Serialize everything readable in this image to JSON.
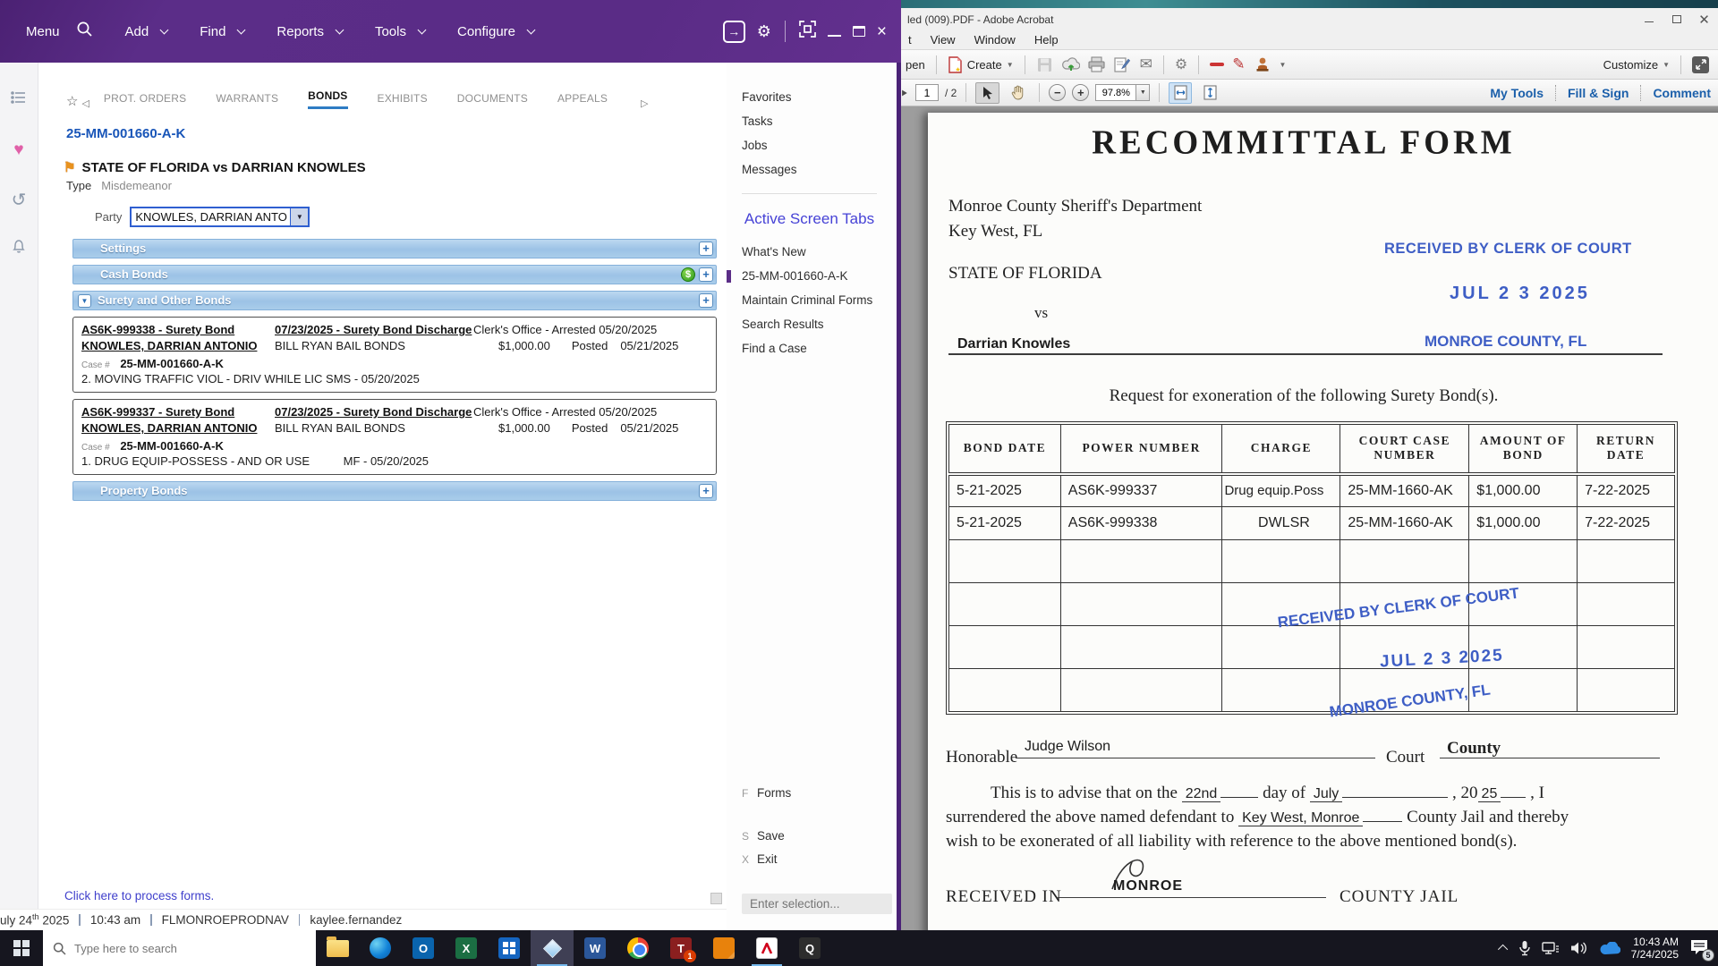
{
  "odyssey": {
    "menu": {
      "items": [
        "Menu",
        "Add",
        "Find",
        "Reports",
        "Tools",
        "Configure"
      ]
    },
    "tabs": {
      "items": [
        "PROT. ORDERS",
        "WARRANTS",
        "BONDS",
        "EXHIBITS",
        "DOCUMENTS",
        "APPEALS"
      ],
      "active": "BONDS"
    },
    "case": {
      "number": "25-MM-001660-A-K",
      "title": "STATE OF FLORIDA vs DARRIAN KNOWLES",
      "type_label": "Type",
      "type_value": "Misdemeanor",
      "party_label": "Party",
      "party_value": "KNOWLES, DARRIAN ANTO"
    },
    "sections": {
      "settings": "Settings",
      "cash_bonds": "Cash Bonds",
      "surety": "Surety and Other Bonds",
      "property": "Property Bonds"
    },
    "bonds": [
      {
        "bond_link": "AS6K-999338 - Surety Bond",
        "discharge_link": "07/23/2025 - Surety Bond Discharge",
        "status": "Clerk's Office - Arrested 05/20/2025",
        "party_link": "KNOWLES, DARRIAN ANTONIO",
        "agency": "BILL RYAN BAIL BONDS",
        "amount": "$1,000.00",
        "posted_label": "Posted",
        "posted_date": "05/21/2025",
        "case_label": "Case #",
        "case_number": "25-MM-001660-A-K",
        "charge": "2. MOVING TRAFFIC VIOL - DRIV WHILE LIC SMS - 05/20/2025",
        "charge_code": ""
      },
      {
        "bond_link": "AS6K-999337 - Surety Bond",
        "discharge_link": "07/23/2025 - Surety Bond Discharge",
        "status": "Clerk's Office - Arrested 05/20/2025",
        "party_link": "KNOWLES, DARRIAN ANTONIO",
        "agency": "BILL RYAN BAIL BONDS",
        "amount": "$1,000.00",
        "posted_label": "Posted",
        "posted_date": "05/21/2025",
        "case_label": "Case #",
        "case_number": "25-MM-001660-A-K",
        "charge": "1. DRUG EQUIP-POSSESS - AND OR USE",
        "charge_code": "MF - 05/20/2025"
      }
    ],
    "sidebar": {
      "items": [
        "Favorites",
        "Tasks",
        "Jobs",
        "Messages"
      ],
      "active_tabs_header": "Active Screen Tabs",
      "screen_tabs": [
        "What's New",
        "25-MM-001660-A-K",
        "Maintain Criminal Forms",
        "Search Results",
        "Find a Case"
      ],
      "active_screen_tab": "25-MM-001660-A-K",
      "actions": [
        {
          "key": "F",
          "label": "Forms"
        },
        {
          "key": "S",
          "label": "Save"
        },
        {
          "key": "X",
          "label": "Exit"
        }
      ],
      "selection_placeholder": "Enter selection..."
    },
    "process_forms_link": "Click here to process forms.",
    "status": {
      "date_prefix": "uly 24",
      "date_sup": "th",
      "date_suffix": "2025",
      "time": "10:43 am",
      "environment": "FLMONROEPRODNAV",
      "user": "kaylee.fernandez"
    }
  },
  "acrobat": {
    "title": "led (009).PDF - Adobe Acrobat",
    "menus": [
      "t",
      "View",
      "Window",
      "Help"
    ],
    "toolbar": {
      "open_partial": "pen",
      "create": "Create",
      "customize": "Customize",
      "page_value": "1",
      "page_total": "/ 2",
      "zoom_value": "97.8%",
      "right_tabs": [
        "My Tools",
        "Fill & Sign",
        "Comment"
      ]
    },
    "doc": {
      "title": "RECOMMITTAL FORM",
      "dept_line1": "Monroe County Sheriff's Department",
      "dept_line2": "Key West, FL",
      "state_line": "STATE OF FLORIDA",
      "vs": "vs",
      "defendant": "Darrian Knowles",
      "stamp_received": "RECEIVED BY CLERK OF COURT",
      "stamp_date": "JUL 2 3 2025",
      "stamp_county": "MONROE COUNTY, FL",
      "request_line": "Request for exoneration of the following Surety Bond(s).",
      "table": {
        "headers": [
          "BOND DATE",
          "POWER NUMBER",
          "CHARGE",
          "COURT CASE\nNUMBER",
          "AMOUNT OF\nBOND",
          "RETURN\nDATE"
        ],
        "rows": [
          [
            "5-21-2025",
            "AS6K-999337",
            "Drug equip.Poss",
            "25-MM-1660-AK",
            "$1,000.00",
            "7-22-2025"
          ],
          [
            "5-21-2025",
            "AS6K-999338",
            "DWLSR",
            "25-MM-1660-AK",
            "$1,000.00",
            "7-22-2025"
          ]
        ]
      },
      "honorable_label": "Honorable",
      "honorable_value": "Judge Wilson",
      "court_label": "Court",
      "court_value": "County",
      "advise": {
        "p1": "This is to advise that on the",
        "day": "22nd",
        "p2": "day of",
        "month": "July",
        "year_printed": ", 20",
        "year_written": "25",
        "p3": ", I",
        "p4": "surrendered the above named defendant to",
        "jail": "Key West, Monroe",
        "p5": "County Jail and thereby",
        "p6": "wish to be exonerated of all liability with reference to the above mentioned bond(s)."
      },
      "received_label": "RECEIVED IN",
      "received_value": "MONROE",
      "received_suffix": "COUNTY JAIL"
    }
  },
  "taskbar": {
    "search_placeholder": "Type here to search",
    "clock_time": "10:43 AM",
    "clock_date": "7/24/2025",
    "notification_count": "5",
    "tiles": {
      "outlook": "O",
      "excel": "X",
      "word": "W",
      "teams_t": "T",
      "q": "Q",
      "badge": "1"
    }
  }
}
